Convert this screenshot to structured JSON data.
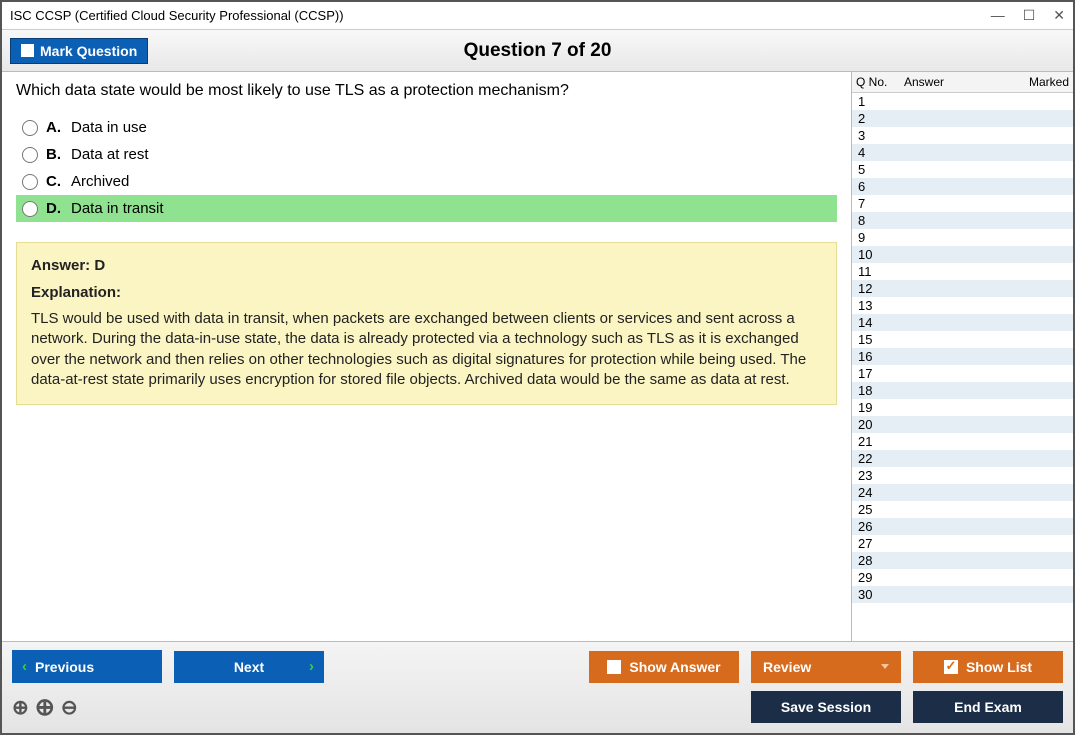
{
  "window": {
    "title": "ISC CCSP (Certified Cloud Security Professional (CCSP))"
  },
  "header": {
    "mark_label": "Mark Question",
    "question_counter": "Question 7 of 20"
  },
  "question": {
    "text": "Which data state would be most likely to use TLS as a protection mechanism?",
    "options": [
      {
        "letter": "A.",
        "text": "Data in use",
        "correct": false
      },
      {
        "letter": "B.",
        "text": "Data at rest",
        "correct": false
      },
      {
        "letter": "C.",
        "text": "Archived",
        "correct": false
      },
      {
        "letter": "D.",
        "text": "Data in transit",
        "correct": true
      }
    ]
  },
  "explanation": {
    "answer_line": "Answer: D",
    "heading": "Explanation:",
    "body": "TLS would be used with data in transit, when packets are exchanged between clients or services and sent across a network. During the data-in-use state, the data is already protected via a technology such as TLS as it is exchanged over the network and then relies on other technologies such as digital signatures for protection while being used. The data-at-rest state primarily uses encryption for stored file objects. Archived data would be the same as data at rest."
  },
  "sidebar": {
    "col_no": "Q No.",
    "col_answer": "Answer",
    "col_marked": "Marked",
    "rows": [
      1,
      2,
      3,
      4,
      5,
      6,
      7,
      8,
      9,
      10,
      11,
      12,
      13,
      14,
      15,
      16,
      17,
      18,
      19,
      20,
      21,
      22,
      23,
      24,
      25,
      26,
      27,
      28,
      29,
      30
    ]
  },
  "footer": {
    "previous": "Previous",
    "next": "Next",
    "show_answer": "Show Answer",
    "review": "Review",
    "show_list": "Show List",
    "save_session": "Save Session",
    "end_exam": "End Exam"
  }
}
